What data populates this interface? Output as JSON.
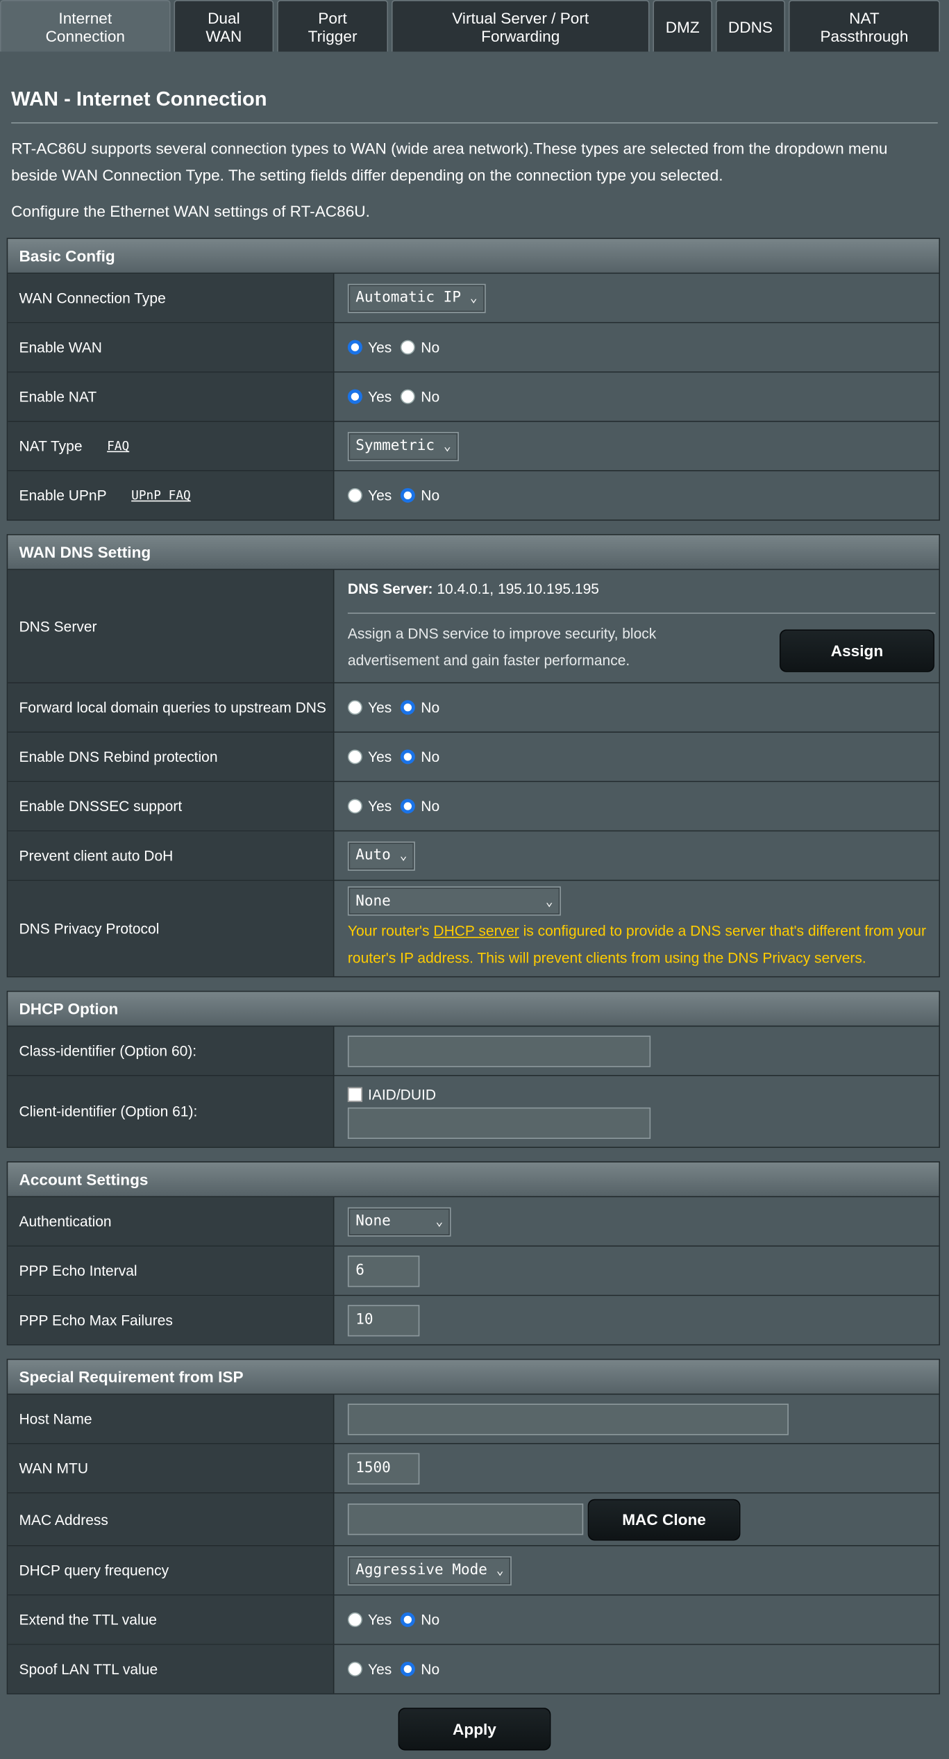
{
  "tabs": [
    {
      "label": "Internet\nConnection"
    },
    {
      "label": "Dual\nWAN"
    },
    {
      "label": "Port\nTrigger"
    },
    {
      "label": "Virtual Server / Port\nForwarding"
    },
    {
      "label": "DMZ"
    },
    {
      "label": "DDNS"
    },
    {
      "label": "NAT\nPassthrough"
    }
  ],
  "page": {
    "title": "WAN - Internet Connection",
    "description": "RT-AC86U supports several connection types to WAN (wide area network).These types are selected from the dropdown menu beside WAN Connection Type. The setting fields differ depending on the connection type you selected.",
    "configure_text": "Configure the Ethernet WAN settings of RT-AC86U."
  },
  "radio": {
    "yes": "Yes",
    "no": "No"
  },
  "basic": {
    "header": "Basic Config",
    "wan_type_label": "WAN Connection Type",
    "wan_type_value": "Automatic IP",
    "enable_wan_label": "Enable WAN",
    "enable_nat_label": "Enable NAT",
    "nat_type_label": "NAT Type",
    "nat_faq": "FAQ",
    "nat_type_value": "Symmetric",
    "upnp_label": "Enable UPnP",
    "upnp_faq": "UPnP FAQ"
  },
  "dns": {
    "header": "WAN DNS Setting",
    "dns_server_label": "DNS Server",
    "dns_server_prefix": "DNS Server:",
    "dns_server_value": "10.4.0.1, 195.10.195.195",
    "assign_text": "Assign a DNS service to improve security, block advertisement and gain faster performance.",
    "assign_button": "Assign",
    "forward_label": "Forward local domain queries to upstream DNS",
    "rebind_label": "Enable DNS Rebind protection",
    "dnssec_label": "Enable DNSSEC support",
    "doh_label": "Prevent client auto DoH",
    "doh_value": "Auto",
    "privacy_label": "DNS Privacy Protocol",
    "privacy_value": "None",
    "warn_part1": "Your router's ",
    "warn_link": "DHCP server",
    "warn_part2": " is configured to provide a DNS server that's different from your router's IP address. This will prevent clients from using the DNS Privacy servers."
  },
  "dhcp": {
    "header": "DHCP Option",
    "class_label": "Class-identifier (Option 60):",
    "client_label": "Client-identifier (Option 61):",
    "iaid_label": "IAID/DUID"
  },
  "account": {
    "header": "Account Settings",
    "auth_label": "Authentication",
    "auth_value": "None",
    "echo_interval_label": "PPP Echo Interval",
    "echo_interval_value": "6",
    "echo_failures_label": "PPP Echo Max Failures",
    "echo_failures_value": "10"
  },
  "isp": {
    "header": "Special Requirement from ISP",
    "host_label": "Host Name",
    "mtu_label": "WAN MTU",
    "mtu_value": "1500",
    "mac_label": "MAC Address",
    "mac_clone": "MAC Clone",
    "dhcp_freq_label": "DHCP query frequency",
    "dhcp_freq_value": "Aggressive Mode",
    "ttl_label": "Extend the TTL value",
    "spoof_label": "Spoof LAN TTL value"
  },
  "apply_button": "Apply"
}
